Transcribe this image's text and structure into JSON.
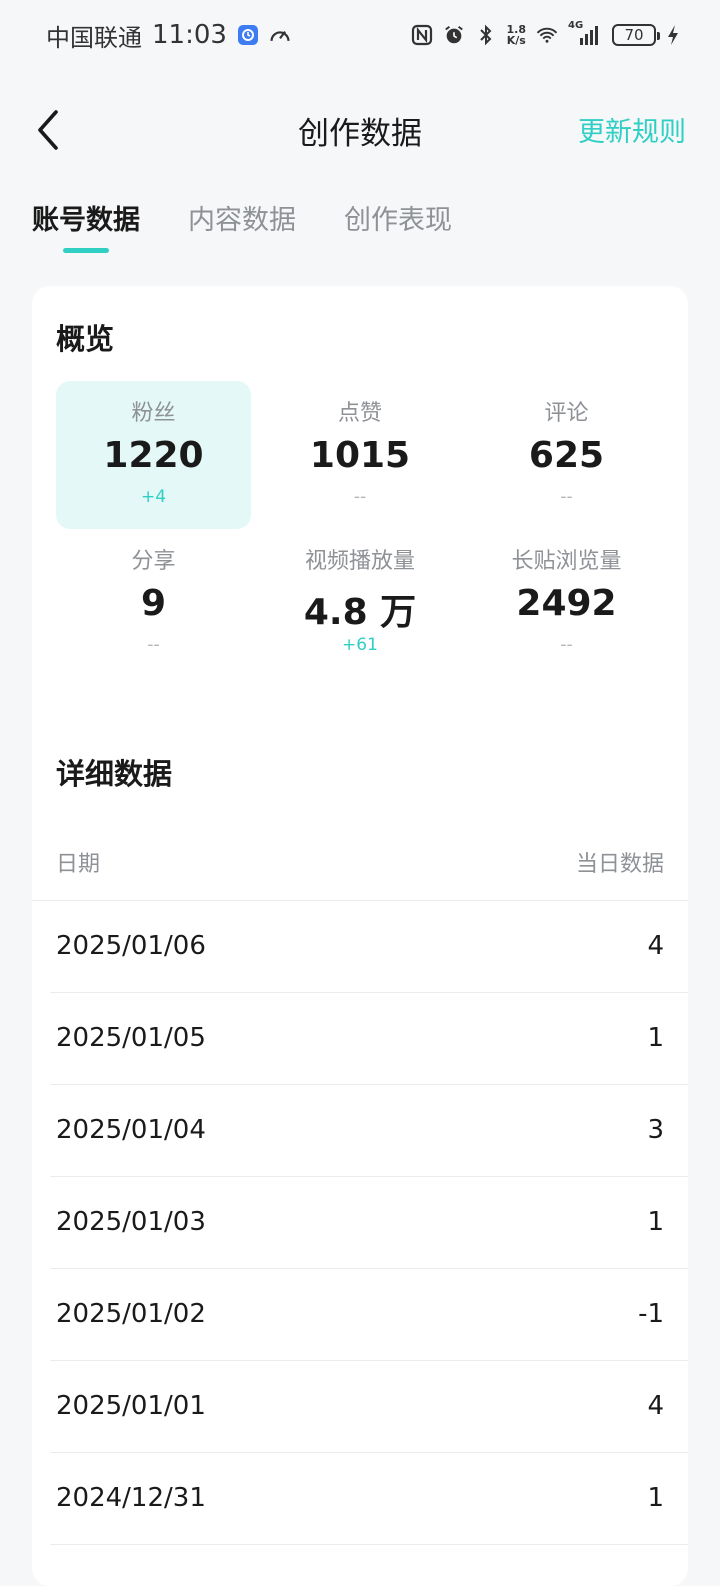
{
  "status_bar": {
    "carrier": "中国联通",
    "time": "11:03",
    "net_speed_value": "1.8",
    "net_speed_unit": "K/s",
    "network_type": "4G",
    "battery": "70"
  },
  "nav": {
    "title": "创作数据",
    "rules_link": "更新规则"
  },
  "tabs": [
    {
      "label": "账号数据",
      "active": true
    },
    {
      "label": "内容数据",
      "active": false
    },
    {
      "label": "创作表现",
      "active": false
    }
  ],
  "overview": {
    "title": "概览",
    "stats": [
      {
        "label": "粉丝",
        "value": "1220",
        "delta": "+4"
      },
      {
        "label": "点赞",
        "value": "1015",
        "delta": "--"
      },
      {
        "label": "评论",
        "value": "625",
        "delta": "--"
      },
      {
        "label": "分享",
        "value": "9",
        "delta": "--"
      },
      {
        "label": "视频播放量",
        "value": "4.8 万",
        "delta": "+61"
      },
      {
        "label": "长贴浏览量",
        "value": "2492",
        "delta": "--"
      }
    ]
  },
  "details": {
    "title": "详细数据",
    "col_date": "日期",
    "col_value": "当日数据",
    "rows": [
      {
        "date": "2025/01/06",
        "value": "4"
      },
      {
        "date": "2025/01/05",
        "value": "1"
      },
      {
        "date": "2025/01/04",
        "value": "3"
      },
      {
        "date": "2025/01/03",
        "value": "1"
      },
      {
        "date": "2025/01/02",
        "value": "-1"
      },
      {
        "date": "2025/01/01",
        "value": "4"
      },
      {
        "date": "2024/12/31",
        "value": "1"
      }
    ]
  },
  "colors": {
    "accent": "#2fcfc4",
    "highlight_bg": "#e3f8f7",
    "page_bg": "#f6f7f9"
  }
}
